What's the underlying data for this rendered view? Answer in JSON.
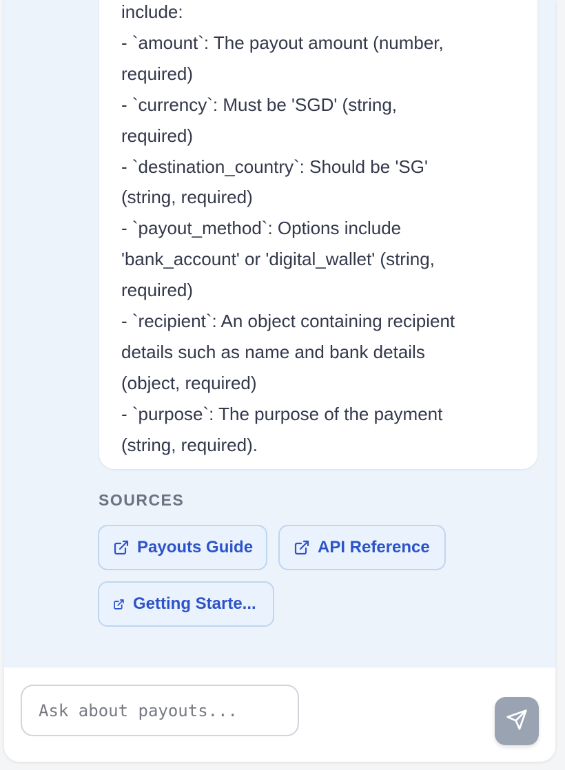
{
  "message": {
    "lines": [
      "include:",
      "- `amount`: The payout amount (number,",
      "required)",
      "- `currency`: Must be 'SGD' (string,",
      "required)",
      "- `destination_country`: Should be 'SG'",
      "(string, required)",
      "- `payout_method`: Options include",
      "'bank_account' or 'digital_wallet' (string,",
      "required)",
      "- `recipient`: An object containing recipient",
      "details such as name and bank details",
      "(object, required)",
      "- `purpose`: The purpose of the payment",
      "(string, required)."
    ]
  },
  "sources": {
    "heading": "SOURCES",
    "links": [
      {
        "label": "Payouts Guide",
        "icon": "external-link-icon"
      },
      {
        "label": "API Reference",
        "icon": "external-link-icon"
      },
      {
        "label": "Getting Starte...",
        "icon": "external-link-icon"
      }
    ]
  },
  "composer": {
    "placeholder": "Ask about payouts...",
    "send_icon": "send-icon"
  },
  "colors": {
    "panel_bg": "#edf3fb",
    "chip_bg": "#eaf2fd",
    "chip_border": "#bfd5f0",
    "chip_text": "#2d53c8",
    "send_button": "#9aa3b1"
  }
}
